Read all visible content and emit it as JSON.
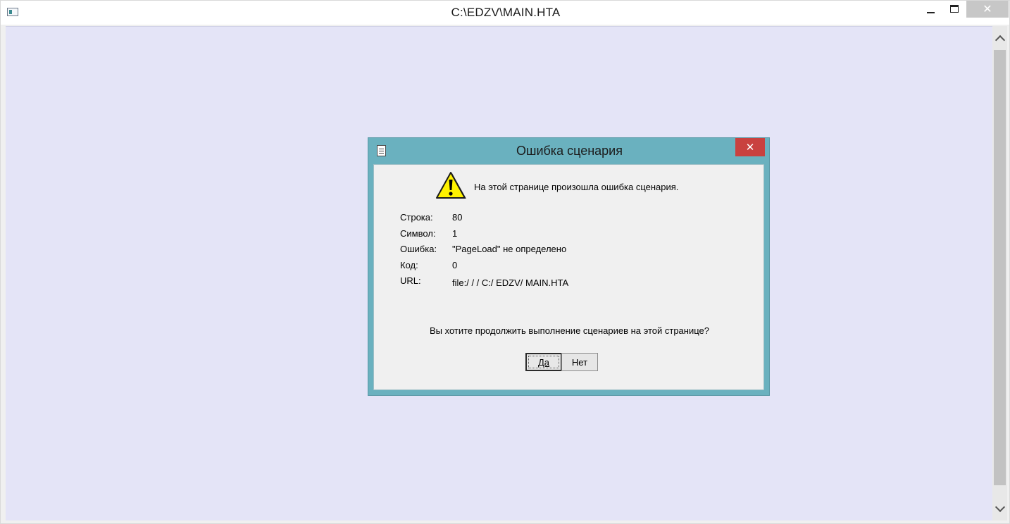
{
  "window": {
    "title": "C:\\EDZV\\MAIN.HTA",
    "controls": {
      "minimize": "minimize",
      "maximize": "maximize",
      "close": "✕"
    }
  },
  "dialog": {
    "title": "Ошибка сценария",
    "close": "✕",
    "message": "На этой странице произошла ошибка сценария.",
    "details": [
      {
        "label": "Строка:",
        "value": "80"
      },
      {
        "label": "Символ:",
        "value": "1"
      },
      {
        "label": "Ошибка:",
        "value": "\"PageLoad\" не определено"
      },
      {
        "label": "Код:",
        "value": "0"
      },
      {
        "label": "URL:",
        "value": "file:/ / / C:/ EDZV/ MAIN.HTA"
      }
    ],
    "question": "Вы хотите продолжить выполнение сценариев на этой странице?",
    "yes_label": "Да",
    "no_label": "Нет"
  },
  "colors": {
    "dialog_frame": "#6ab1bf",
    "dialog_close": "#c9413f",
    "content_background": "#e4e4f7",
    "warning_yellow": "#fff200"
  },
  "icons": {
    "app": "app-window-icon",
    "dialog": "document-icon",
    "warning": "warning-icon"
  }
}
